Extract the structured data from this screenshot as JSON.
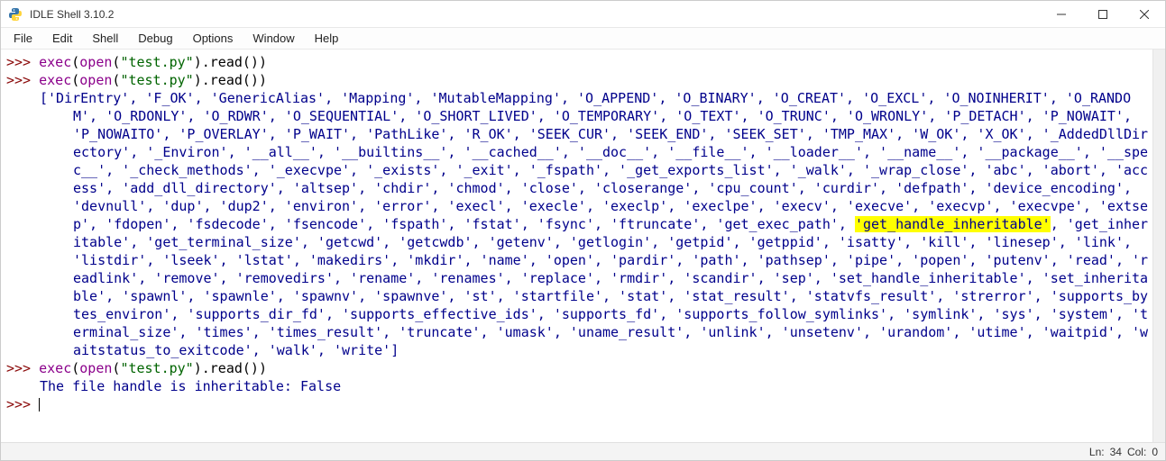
{
  "window": {
    "title": "IDLE Shell 3.10.2"
  },
  "menu": {
    "file": "File",
    "edit": "Edit",
    "shell": "Shell",
    "debug": "Debug",
    "options": "Options",
    "window": "Window",
    "help": "Help"
  },
  "code": {
    "prompt": ">>> ",
    "exec_kw": "exec",
    "open_kw": "open",
    "str_test": "\"test.py\"",
    "read_tail": ").read())",
    "paren_open": "(",
    "output_list_pre": "['DirEntry', 'F_OK', 'GenericAlias', 'Mapping', 'MutableMapping', 'O_APPEND', 'O_BINARY', 'O_CREAT', 'O_EXCL', 'O_NOINHERIT', 'O_RANDOM', 'O_RDONLY', 'O_RDWR', 'O_SEQUENTIAL', 'O_SHORT_LIVED', 'O_TEMPORARY', 'O_TEXT', 'O_TRUNC', 'O_WRONLY', 'P_DETACH', 'P_NOWAIT', 'P_NOWAITO', 'P_OVERLAY', 'P_WAIT', 'PathLike', 'R_OK', 'SEEK_CUR', 'SEEK_END', 'SEEK_SET', 'TMP_MAX', 'W_OK', 'X_OK', '_AddedDllDirectory', '_Environ', '__all__', '__builtins__', '__cached__', '__doc__', '__file__', '__loader__', '__name__', '__package__', '__spec__', '_check_methods', '_execvpe', '_exists', '_exit', '_fspath', '_get_exports_list', '_walk', '_wrap_close', 'abc', 'abort', 'access', 'add_dll_directory', 'altsep', 'chdir', 'chmod', 'close', 'closerange', 'cpu_count', 'curdir', 'defpath', 'device_encoding', 'devnull', 'dup', 'dup2', 'environ', 'error', 'execl', 'execle', 'execlp', 'execlpe', 'execv', 'execve', 'execvp', 'execvpe', 'extsep', 'fdopen', 'fsdecode', 'fsencode', 'fspath', 'fstat', 'fsync', 'ftruncate', 'get_exec_path', ",
    "highlighted": "'get_handle_inheritable'",
    "output_list_post": ", 'get_inheritable', 'get_terminal_size', 'getcwd', 'getcwdb', 'getenv', 'getlogin', 'getpid', 'getppid', 'isatty', 'kill', 'linesep', 'link', 'listdir', 'lseek', 'lstat', 'makedirs', 'mkdir', 'name', 'open', 'pardir', 'path', 'pathsep', 'pipe', 'popen', 'putenv', 'read', 'readlink', 'remove', 'removedirs', 'rename', 'renames', 'replace', 'rmdir', 'scandir', 'sep', 'set_handle_inheritable', 'set_inheritable', 'spawnl', 'spawnle', 'spawnv', 'spawnve', 'st', 'startfile', 'stat', 'stat_result', 'statvfs_result', 'strerror', 'supports_bytes_environ', 'supports_dir_fd', 'supports_effective_ids', 'supports_fd', 'supports_follow_symlinks', 'symlink', 'sys', 'system', 'terminal_size', 'times', 'times_result', 'truncate', 'umask', 'uname_result', 'unlink', 'unsetenv', 'urandom', 'utime', 'waitpid', 'waitstatus_to_exitcode', 'walk', 'write']",
    "output_msg": "The file handle is inheritable: False"
  },
  "status": {
    "ln_label": "Ln:",
    "ln_val": "34",
    "col_label": "Col:",
    "col_val": "0"
  }
}
